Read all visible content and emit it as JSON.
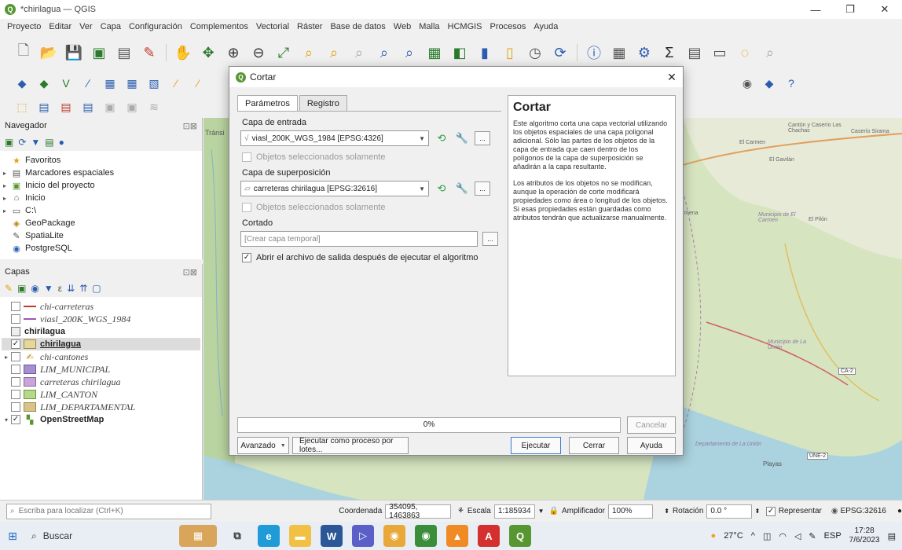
{
  "window": {
    "title": "*chirilagua — QGIS",
    "app_icon": "Q",
    "minimize": "—",
    "maximize": "❐",
    "close": "✕"
  },
  "menu": [
    "Proyecto",
    "Editar",
    "Ver",
    "Capa",
    "Configuración",
    "Complementos",
    "Vectorial",
    "Ráster",
    "Base de datos",
    "Web",
    "Malla",
    "HCMGIS",
    "Procesos",
    "Ayuda"
  ],
  "navigator": {
    "title": "Navegador",
    "items": [
      {
        "label": "Favoritos",
        "icon": "★",
        "arrow": ""
      },
      {
        "label": "Marcadores espaciales",
        "icon": "▤",
        "arrow": "▸"
      },
      {
        "label": "Inicio del proyecto",
        "icon": "▣",
        "arrow": "▸"
      },
      {
        "label": "Inicio",
        "icon": "⌂",
        "arrow": "▸"
      },
      {
        "label": "C:\\",
        "icon": "▭",
        "arrow": "▸"
      },
      {
        "label": "GeoPackage",
        "icon": "◈",
        "arrow": ""
      },
      {
        "label": "SpatiaLite",
        "icon": "✎",
        "arrow": ""
      },
      {
        "label": "PostgreSQL",
        "icon": "◉",
        "arrow": ""
      }
    ]
  },
  "layers_panel": {
    "title": "Capas",
    "items": [
      {
        "label": "chi-carreteras",
        "style": "it"
      },
      {
        "label": "viasl_200K_WGS_1984",
        "style": "it"
      },
      {
        "label": "chirilagua",
        "style": "bold"
      },
      {
        "label": "chirilagua",
        "style": "bold"
      },
      {
        "label": "chi-cantones",
        "style": "it"
      },
      {
        "label": "LIM_MUNICIPAL",
        "style": "it"
      },
      {
        "label": "carreteras chirilagua",
        "style": "it"
      },
      {
        "label": "LIM_CANTON",
        "style": "it"
      },
      {
        "label": "LIM_DEPARTAMENTAL",
        "style": "it"
      },
      {
        "label": "OpenStreetMap",
        "style": "bold"
      }
    ]
  },
  "map": {
    "left_label": "Tránsi",
    "labels": [
      "Cantón y Caserío Las Chachas",
      "Caserío Sirama",
      "El Carmen",
      "El Gavilán",
      "Municipio de El Carmen",
      "El Pilón",
      "Municipio de La Unión",
      "CA-2",
      "Departamento de La Unión",
      "Playas",
      "UNE-2",
      "mena"
    ]
  },
  "dialog": {
    "title": "Cortar",
    "close": "✕",
    "tabs": [
      "Parámetros",
      "Registro"
    ],
    "input_label": "Capa de entrada",
    "input_value": "viasl_200K_WGS_1984 [EPSG:4326]",
    "selected_only": "Objetos seleccionados solamente",
    "overlay_label": "Capa de superposición",
    "overlay_value": "carreteras chirilagua [EPSG:32616]",
    "output_label": "Cortado",
    "output_placeholder": "[Crear capa temporal]",
    "open_output": "Abrir el archivo de salida después de ejecutar el algoritmo",
    "dots": "...",
    "help_title": "Cortar",
    "help_p1": "Este algoritmo corta una capa vectorial utilizando los objetos espaciales de una capa poligonal adicional. Sólo las partes de los objetos de la capa de entrada que caen dentro de los polígonos de la capa de superposición se añadirán a la capa resultante.",
    "help_p2": "Los atributos de los objetos no se modifican, aunque la operación de corte modificará propiedades como área o longitud de los objetos. Si esas propiedades están guardadas como atributos tendrán que actualizarse manualmente.",
    "progress": "0%",
    "progress_value": 0,
    "cancel": "Cancelar",
    "advanced": "Avanzado",
    "batch": "Ejecutar como proceso por lotes...",
    "run": "Ejecutar",
    "close_btn": "Cerrar",
    "help_btn": "Ayuda"
  },
  "statusbar": {
    "locator_placeholder": "Escriba para localizar (Ctrl+K)",
    "coord_label": "Coordenada",
    "coord_value": "354095, 1463863",
    "scale_label": "Escala",
    "scale_value": "1:185934",
    "magnifier_label": "Amplificador",
    "magnifier_value": "100%",
    "rotation_label": "Rotación",
    "rotation_value": "0.0 °",
    "render_label": "Representar",
    "crs": "EPSG:32616"
  },
  "taskbar": {
    "search": "Buscar",
    "temp": "27°C",
    "lang": "ESP",
    "time": "17:28",
    "date": "7/6/2023"
  },
  "colors": {
    "qgis_green": "#589632",
    "map_land": "#c8dbb0",
    "sea": "#aad3df",
    "accent": "#3a7bd5"
  }
}
